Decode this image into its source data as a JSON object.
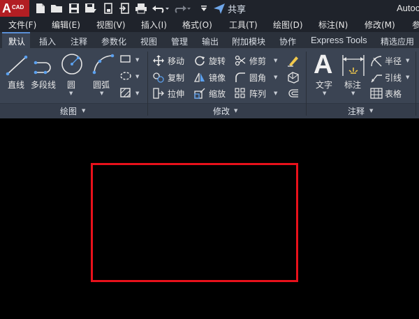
{
  "app": {
    "logo_letter": "A",
    "logo_sub": "CAD",
    "title": "Autoc"
  },
  "quick_access": {
    "share_label": "共享",
    "icons": [
      "new-file-icon",
      "open-folder-icon",
      "save-icon",
      "save-as-icon",
      "share-file-icon",
      "import-icon",
      "print-icon",
      "undo-icon",
      "redo-icon",
      "customize-icon"
    ]
  },
  "menu": [
    "文件(F)",
    "编辑(E)",
    "视图(V)",
    "插入(I)",
    "格式(O)",
    "工具(T)",
    "绘图(D)",
    "标注(N)",
    "修改(M)",
    "参"
  ],
  "tabs": [
    "默认",
    "插入",
    "注释",
    "参数化",
    "视图",
    "管理",
    "输出",
    "附加模块",
    "协作",
    "Express Tools",
    "精选应用"
  ],
  "active_tab": "默认",
  "panels": {
    "draw": {
      "title": "绘图",
      "tools": [
        "直线",
        "多段线",
        "圆",
        "圆弧"
      ]
    },
    "modify": {
      "title": "修改",
      "tools": [
        "移动",
        "旋转",
        "修剪",
        "复制",
        "镜像",
        "圆角",
        "拉伸",
        "缩放",
        "阵列"
      ]
    },
    "annotation": {
      "title": "注释",
      "big_tools": [
        "文字",
        "标注"
      ],
      "small_tools": [
        "半径",
        "引线",
        "表格"
      ],
      "text_glyph": "A"
    }
  },
  "colors": {
    "accent": "#5a8fd6",
    "rectangle": "#e8111b",
    "logo": "#b21e23"
  }
}
